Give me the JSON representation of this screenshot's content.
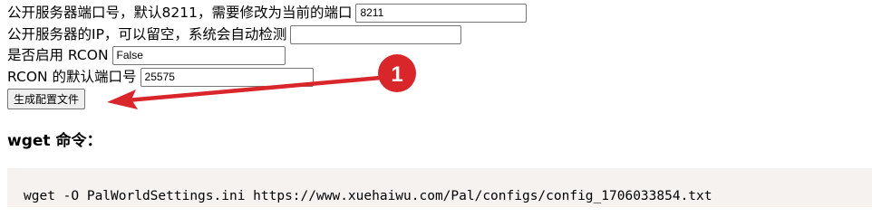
{
  "form": {
    "port": {
      "label": "公开服务器端口号，默认8211，需要修改为当前的端口",
      "value": "8211"
    },
    "ip": {
      "label": "公开服务器的IP，可以留空，系统会自动检测",
      "value": ""
    },
    "rcon_enabled": {
      "label": "是否启用 RCON",
      "value": "False"
    },
    "rcon_port": {
      "label": "RCON 的默认端口号",
      "value": "25575"
    },
    "generate_button": "生成配置文件"
  },
  "section": {
    "heading": "wget 命令："
  },
  "command": {
    "text": "wget -O PalWorldSettings.ini https://www.xuehaiwu.com/Pal/configs/config_1706033854.txt"
  },
  "annotation": {
    "number": "1",
    "color": "#d9262b"
  }
}
